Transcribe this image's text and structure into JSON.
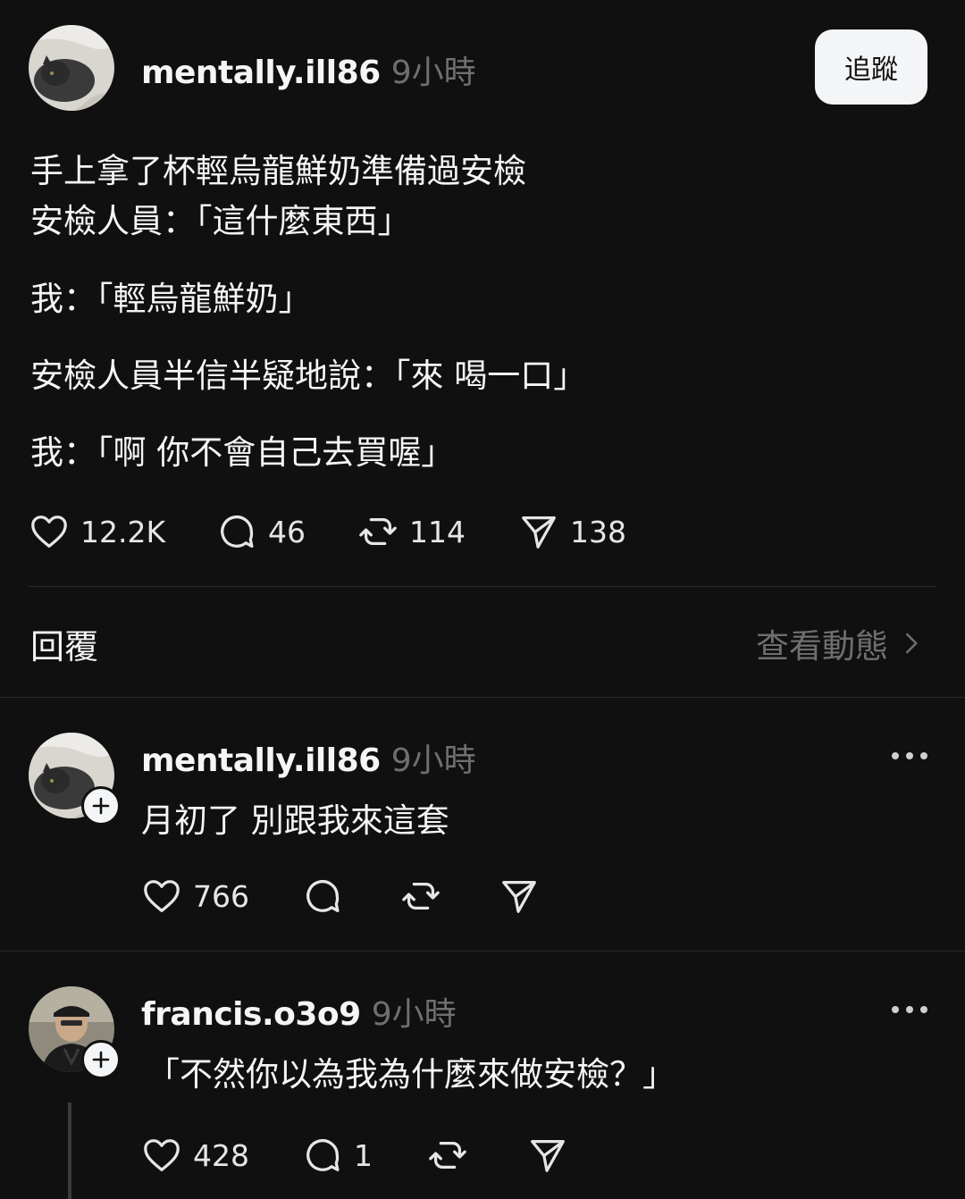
{
  "post": {
    "username": "mentally.ill86",
    "time": "9小時",
    "follow_label": "追蹤",
    "lines": [
      "手上拿了杯輕烏龍鮮奶準備過安檢",
      "安檢人員：「這什麼東西」",
      "我：「輕烏龍鮮奶」",
      "安檢人員半信半疑地說：「來 喝一口」",
      "我：「啊 你不會自己去買喔」"
    ],
    "likes": "12.2K",
    "comments": "46",
    "reposts": "114",
    "shares": "138"
  },
  "replies_bar": {
    "title": "回覆",
    "view_activity": "查看動態"
  },
  "replies": [
    {
      "username": "mentally.ill86",
      "time": "9小時",
      "text": "月初了 別跟我來這套",
      "likes": "766"
    },
    {
      "username": "francis.o3o9",
      "time": "9小時",
      "text": "「不然你以為我為什麼來做安檢？」",
      "likes": "428",
      "comments": "1"
    }
  ],
  "icons": {
    "like": "heart-icon",
    "comment": "comment-icon",
    "repost": "repost-icon",
    "share": "share-icon",
    "more": "more-icon",
    "add": "plus-icon",
    "chevron": "chevron-right-icon"
  },
  "colors": {
    "background": "#101010",
    "text": "#f3f5f7",
    "secondary": "#6f6f6f",
    "divider": "#2a2a2a",
    "button_bg": "#f3f5f7"
  }
}
